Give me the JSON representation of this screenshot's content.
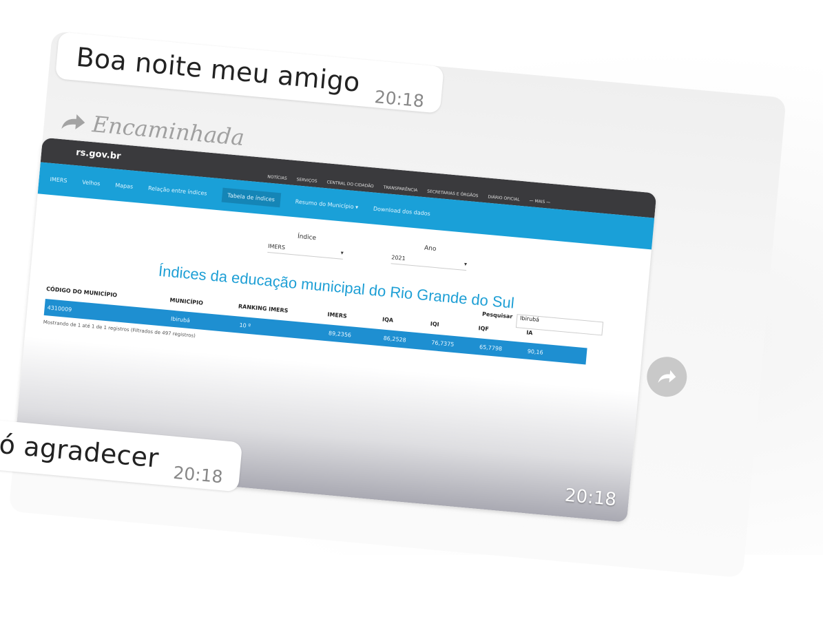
{
  "messages": {
    "first": {
      "text": "Boa noite meu amigo",
      "time": "20:18"
    },
    "forwarded_label": "Encaminhada",
    "last": {
      "text": "Só agradecer",
      "time": "20:18"
    }
  },
  "forwarded_image": {
    "time": "20:18",
    "site": "rs.gov.br",
    "top_nav": [
      "NOTÍCIAS",
      "SERVIÇOS",
      "CENTRAL DO CIDADÃO",
      "TRANSPARÊNCIA",
      "SECRETARIAS E ÓRGÃOS",
      "DIÁRIO OFICIAL",
      "— MAIS —"
    ],
    "nav": [
      "IMERS",
      "Velhos",
      "Mapas",
      "Relação entre índices",
      "Tabela de índices",
      "Resumo do Município ▾",
      "Download dos dados"
    ],
    "form": {
      "indice_label": "Índice",
      "indice_value": "IMERS",
      "ano_label": "Ano",
      "ano_value": "2021"
    },
    "heading": "Índices da educação municipal do Rio Grande do Sul",
    "search_label": "Pesquisar",
    "search_value": "Ibirubá",
    "columns": [
      "CÓDIGO DO MUNICÍPIO",
      "MUNICÍPIO",
      "RANKING IMERS",
      "IMERS",
      "IQA",
      "IQI",
      "IQF",
      "IA"
    ],
    "row": [
      "4310009",
      "Ibirubá",
      "10 º",
      "89,2356",
      "86,2528",
      "76,7375",
      "65,7798",
      "90,16"
    ],
    "showing": "Mostrando de 1 até 1 de 1 registros (Filtrados de 497 registros)"
  }
}
